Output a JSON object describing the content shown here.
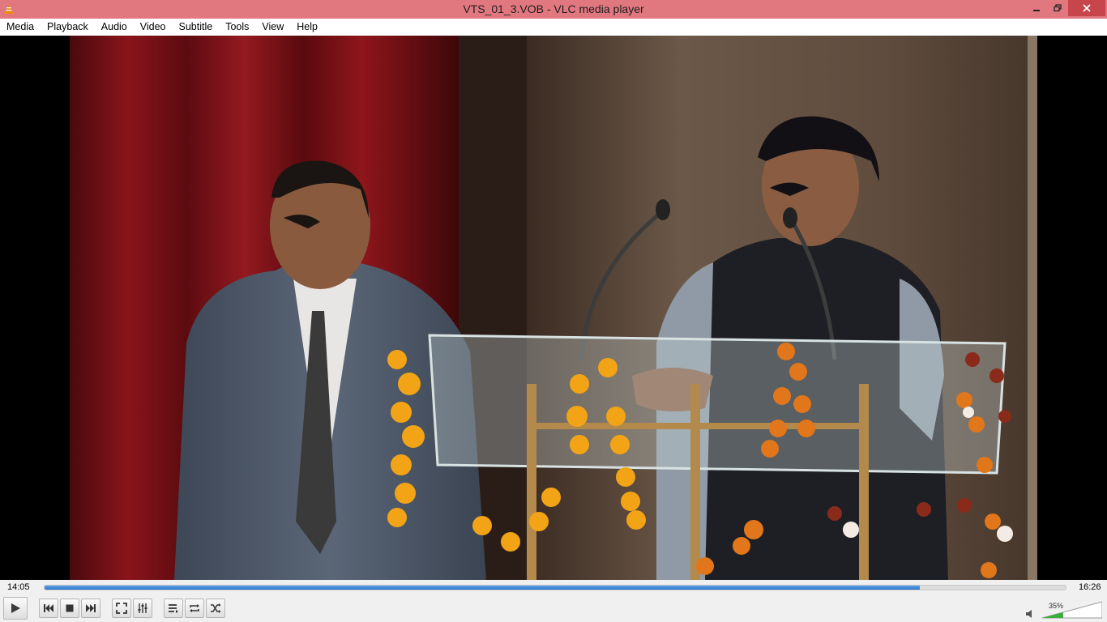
{
  "window": {
    "title": "VTS_01_3.VOB - VLC media player",
    "app_icon": "vlc-cone-icon",
    "title_bar_color": "#e2787f"
  },
  "menu": {
    "items": [
      "Media",
      "Playback",
      "Audio",
      "Video",
      "Subtitle",
      "Tools",
      "View",
      "Help"
    ]
  },
  "player": {
    "elapsed": "14:05",
    "total": "16:26",
    "progress": 0.857,
    "accent_color": "#2a75c9"
  },
  "volume": {
    "label": "35%",
    "level": 0.35,
    "icon": "speaker-icon"
  },
  "controls": {
    "icons": [
      "play-icon",
      "previous-icon",
      "stop-icon",
      "next-icon",
      "fullscreen-icon",
      "extended-settings-icon",
      "playlist-icon",
      "loop-icon",
      "shuffle-icon"
    ]
  }
}
